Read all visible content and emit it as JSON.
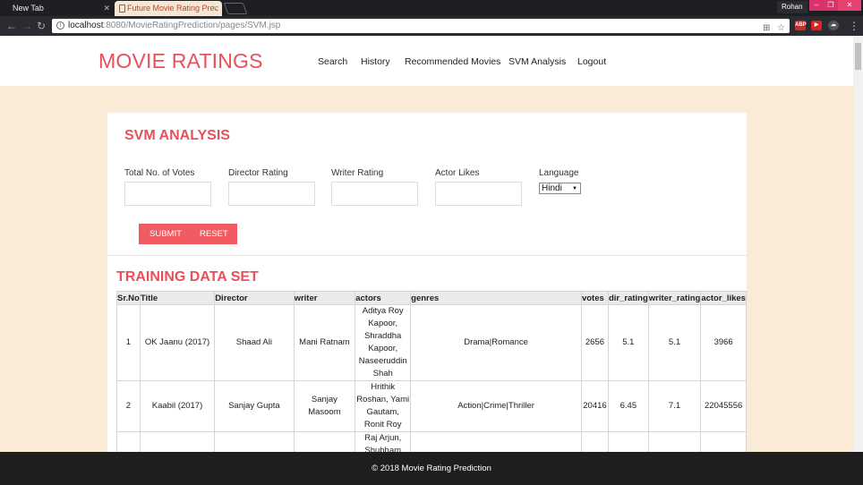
{
  "browser": {
    "tabs": [
      {
        "title": "New Tab"
      },
      {
        "title": "Future Movie Rating Prec"
      }
    ],
    "user": "Rohan",
    "url_host": "localhost",
    "url_path": ":8080/MovieRatingPrediction/pages/SVM.jsp"
  },
  "header": {
    "logo": "MOVIE RATINGS",
    "menu": [
      "Search",
      "History",
      "Recommended Movies",
      "SVM Analysis",
      "Logout"
    ]
  },
  "form": {
    "title": "SVM ANALYSIS",
    "fields": [
      "Total No. of Votes",
      "Director Rating",
      "Writer Rating",
      "Actor Likes"
    ],
    "language_label": "Language",
    "language_value": "Hindi",
    "submit": "SUBMIT",
    "reset": "RESET"
  },
  "table": {
    "title": "TRAINING DATA SET",
    "columns": [
      "Sr.No",
      "Title",
      "Director",
      "writer",
      "actors",
      "genres",
      "votes",
      "dir_rating",
      "writer_rating",
      "actor_likes"
    ],
    "rows": [
      [
        "1",
        "OK Jaanu (2017)",
        "Shaad Ali",
        "Mani Ratnam",
        "Aditya Roy Kapoor, Shraddha Kapoor, Naseeruddin Shah",
        "Drama|Romance",
        "2656",
        "5.1",
        "5.1",
        "3966"
      ],
      [
        "2",
        "Kaabil (2017)",
        "Sanjay Gupta",
        "Sanjay Masoom",
        "Hrithik Roshan, Yami Gautam, Ronit Roy",
        "Action|Crime|Thriller",
        "20416",
        "6.45",
        "7.1",
        "22045556"
      ],
      [
        "",
        "",
        "",
        "",
        "Raj Arjun, Shubham",
        "",
        "",
        "",
        "",
        ""
      ]
    ]
  },
  "footer": {
    "text": "© 2018 Movie Rating Prediction"
  },
  "colors": {
    "accent": "#e8505b",
    "page_bg": "#faebd7",
    "footer_bg": "#1e1e1e"
  }
}
